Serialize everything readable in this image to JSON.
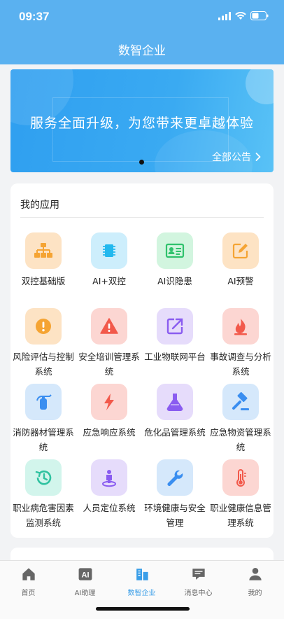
{
  "status_bar": {
    "time": "09:37"
  },
  "nav": {
    "title": "数智企业"
  },
  "banner": {
    "text": "服务全面升级，为您带来更卓越体验",
    "notice_link": "全部公告"
  },
  "apps": {
    "title": "我的应用",
    "items": [
      {
        "label": "双控基础版",
        "icon": "org-chart-icon",
        "bg": "#fde3c4",
        "color": "#f5a433"
      },
      {
        "label": "AI+双控",
        "icon": "chip-icon",
        "bg": "#cdeefc",
        "color": "#22b8ee"
      },
      {
        "label": "AI识隐患",
        "icon": "id-card-icon",
        "bg": "#d2f5df",
        "color": "#2fc26c"
      },
      {
        "label": "AI预警",
        "icon": "edit-icon",
        "bg": "#fde3c4",
        "color": "#f5a433"
      },
      {
        "label": "风险评估与控制系统",
        "icon": "alert-icon",
        "bg": "#fde3c4",
        "color": "#f5a433"
      },
      {
        "label": "安全培训管理系统",
        "icon": "warning-icon",
        "bg": "#fcd6d2",
        "color": "#f2594b"
      },
      {
        "label": "工业物联网平台",
        "icon": "share-icon",
        "bg": "#e6dcfb",
        "color": "#8a5cf0"
      },
      {
        "label": "事故调查与分析系统",
        "icon": "flame-icon",
        "bg": "#fcd6d2",
        "color": "#f2594b"
      },
      {
        "label": "消防器材管理系统",
        "icon": "extinguisher-icon",
        "bg": "#d5e8fb",
        "color": "#3a8ef0"
      },
      {
        "label": "应急响应系统",
        "icon": "lightning-icon",
        "bg": "#fcd6d2",
        "color": "#f2594b"
      },
      {
        "label": "危化品管理系统",
        "icon": "flask-icon",
        "bg": "#e6dcfb",
        "color": "#8a5cf0"
      },
      {
        "label": "应急物资管理系统",
        "icon": "hammer-icon",
        "bg": "#d5e8fb",
        "color": "#3a8ef0"
      },
      {
        "label": "职业病危害因素监测系统",
        "icon": "history-icon",
        "bg": "#d2f5ec",
        "color": "#2fc2a0"
      },
      {
        "label": "人员定位系统",
        "icon": "person-pin-icon",
        "bg": "#e6dcfb",
        "color": "#8a5cf0"
      },
      {
        "label": "环境健康与安全管理",
        "icon": "wrench-icon",
        "bg": "#d5e8fb",
        "color": "#3a8ef0"
      },
      {
        "label": "职业健康信息管理系统",
        "icon": "thermometer-icon",
        "bg": "#fcd6d2",
        "color": "#f2594b"
      }
    ]
  },
  "tabbar": {
    "items": [
      {
        "label": "首页",
        "icon": "home-icon"
      },
      {
        "label": "AI助理",
        "icon": "ai-icon"
      },
      {
        "label": "数智企业",
        "icon": "building-icon",
        "active": true
      },
      {
        "label": "消息中心",
        "icon": "message-icon"
      },
      {
        "label": "我的",
        "icon": "profile-icon"
      }
    ]
  }
}
